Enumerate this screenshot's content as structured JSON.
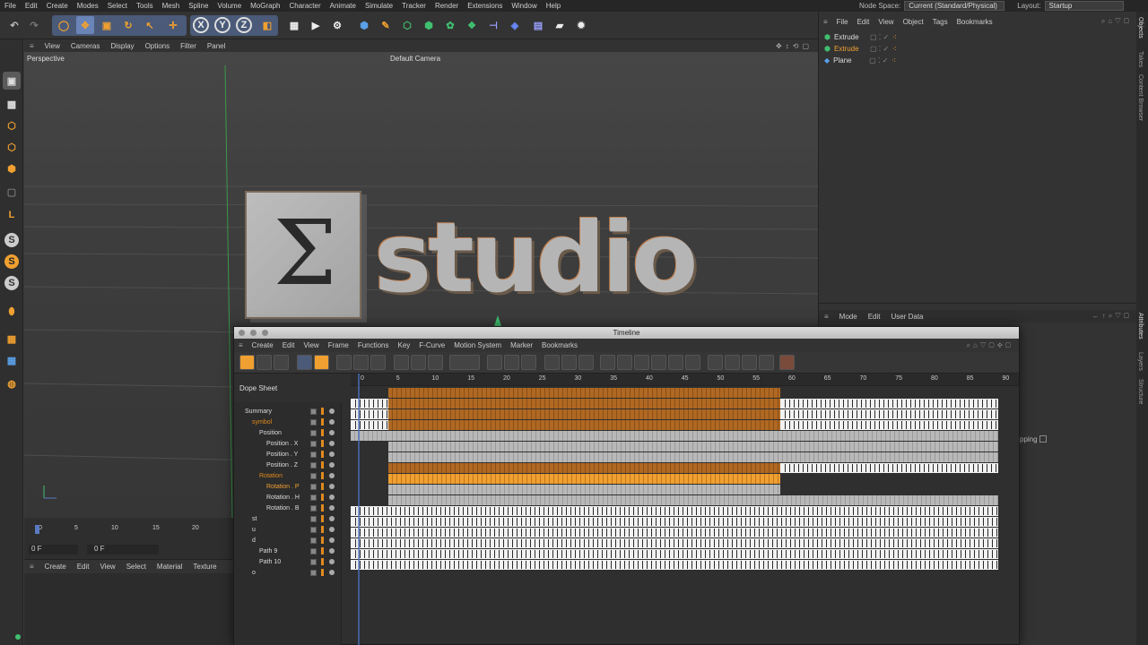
{
  "menubar": {
    "items": [
      "File",
      "Edit",
      "Create",
      "Modes",
      "Select",
      "Tools",
      "Mesh",
      "Spline",
      "Volume",
      "MoGraph",
      "Character",
      "Animate",
      "Simulate",
      "Tracker",
      "Render",
      "Extensions",
      "Window",
      "Help"
    ],
    "node_space_label": "Node Space:",
    "node_space_value": "Current (Standard/Physical)",
    "layout_label": "Layout:",
    "layout_value": "Startup"
  },
  "viewport": {
    "menu": [
      "View",
      "Cameras",
      "Display",
      "Options",
      "Filter",
      "Panel"
    ],
    "title": "Perspective",
    "camera": "Default Camera",
    "logo_glyph": "Σ",
    "logo_text": "studio"
  },
  "frame_strip": {
    "ticks": [
      "0",
      "5",
      "10",
      "15",
      "20"
    ],
    "current_frame": "0 F",
    "field2": "0 F"
  },
  "material_menu": [
    "Create",
    "Edit",
    "View",
    "Select",
    "Material",
    "Texture"
  ],
  "objects": {
    "menu": [
      "File",
      "Edit",
      "View",
      "Object",
      "Tags",
      "Bookmarks"
    ],
    "rows": [
      {
        "name": "Extrude",
        "color": "#dcdcdc"
      },
      {
        "name": "Extrude",
        "color": "#f0a030"
      },
      {
        "name": "Plane",
        "color": "#dcdcdc"
      }
    ]
  },
  "attributes": {
    "menu": [
      "Mode",
      "Edit",
      "User Data"
    ],
    "snapping_label": "pping"
  },
  "side_tabs": [
    "Objects",
    "Takes",
    "Content Browser",
    "Layers",
    "Structure",
    "Attributes"
  ],
  "timeline": {
    "title": "Timeline",
    "menu": [
      "Create",
      "Edit",
      "View",
      "Frame",
      "Functions",
      "Key",
      "F-Curve",
      "Motion System",
      "Marker",
      "Bookmarks"
    ],
    "mode_label": "Dope Sheet",
    "ruler": [
      "0",
      "5",
      "10",
      "15",
      "20",
      "25",
      "30",
      "35",
      "40",
      "45",
      "50",
      "55",
      "60",
      "65",
      "70",
      "75",
      "80",
      "85",
      "90"
    ],
    "tree": [
      {
        "label": "Summary",
        "indent": 0,
        "color": "#dcdcdc"
      },
      {
        "label": "symbol",
        "indent": 1,
        "color": "#e08a1e"
      },
      {
        "label": "Position",
        "indent": 2,
        "color": "#dcdcdc"
      },
      {
        "label": "Position . X",
        "indent": 3,
        "color": "#dcdcdc"
      },
      {
        "label": "Position . Y",
        "indent": 3,
        "color": "#dcdcdc"
      },
      {
        "label": "Position . Z",
        "indent": 3,
        "color": "#dcdcdc"
      },
      {
        "label": "Rotation",
        "indent": 2,
        "color": "#e08a1e"
      },
      {
        "label": "Rotation . P",
        "indent": 3,
        "color": "#f0a030"
      },
      {
        "label": "Rotation . H",
        "indent": 3,
        "color": "#dcdcdc"
      },
      {
        "label": "Rotation . B",
        "indent": 3,
        "color": "#dcdcdc"
      },
      {
        "label": "st",
        "indent": 1,
        "color": "#dcdcdc"
      },
      {
        "label": "u",
        "indent": 1,
        "color": "#dcdcdc"
      },
      {
        "label": "d",
        "indent": 1,
        "color": "#dcdcdc"
      },
      {
        "label": "Path 9",
        "indent": 2,
        "color": "#dcdcdc"
      },
      {
        "label": "Path 10",
        "indent": 2,
        "color": "#dcdcdc"
      },
      {
        "label": "o",
        "indent": 1,
        "color": "#dcdcdc"
      }
    ]
  }
}
